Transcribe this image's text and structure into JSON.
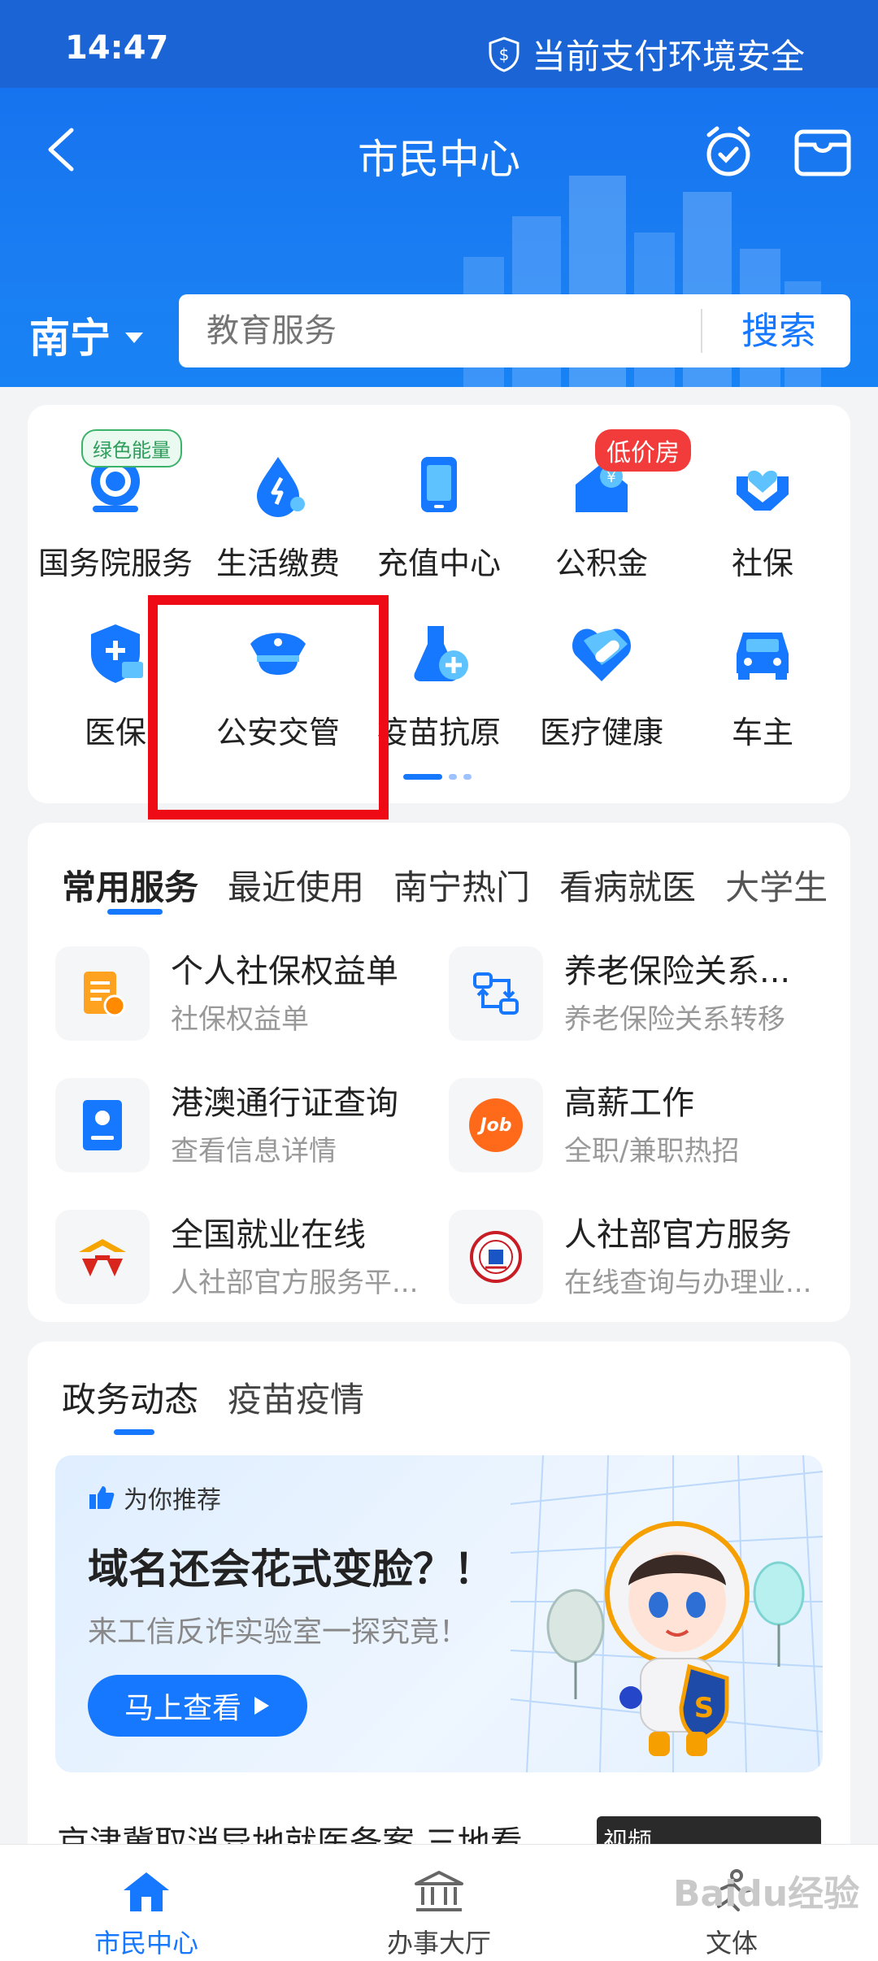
{
  "status_bar": {
    "time": "14:47",
    "safety_text": "当前支付环境安全"
  },
  "header": {
    "title": "市民中心"
  },
  "city": {
    "name": "南宁"
  },
  "search": {
    "placeholder": "教育服务",
    "button_label": "搜索"
  },
  "grid": {
    "tags": {
      "green": "绿色能量",
      "red": "低价房"
    },
    "row1": [
      {
        "label": "国务院服务",
        "icon": "state-council-icon"
      },
      {
        "label": "生活缴费",
        "icon": "utility-payment-icon"
      },
      {
        "label": "充值中心",
        "icon": "phone-recharge-icon"
      },
      {
        "label": "公积金",
        "icon": "housing-fund-icon"
      },
      {
        "label": "社保",
        "icon": "social-security-icon"
      }
    ],
    "row2": [
      {
        "label": "医保",
        "icon": "medical-insurance-icon"
      },
      {
        "label": "公安交管",
        "icon": "police-traffic-icon"
      },
      {
        "label": "疫苗抗原",
        "icon": "vaccine-antigen-icon"
      },
      {
        "label": "医疗健康",
        "icon": "medical-health-icon"
      },
      {
        "label": "车主",
        "icon": "car-owner-icon"
      }
    ]
  },
  "services": {
    "tabs": [
      "常用服务",
      "最近使用",
      "南宁热门",
      "看病就医",
      "大学生"
    ],
    "items": [
      {
        "title": "个人社保权益单",
        "subtitle": "社保权益单"
      },
      {
        "title": "养老保险关系...",
        "subtitle": "养老保险关系转移"
      },
      {
        "title": "港澳通行证查询",
        "subtitle": "查看信息详情"
      },
      {
        "title": "高薪工作",
        "subtitle": "全职/兼职热招"
      },
      {
        "title": "全国就业在线",
        "subtitle": "人社部官方服务平..."
      },
      {
        "title": "人社部官方服务",
        "subtitle": "在线查询与办理业..."
      }
    ],
    "job_logo_text": "Job"
  },
  "news": {
    "tabs": [
      "政务动态",
      "疫苗疫情"
    ],
    "banner": {
      "tag": "为你推荐",
      "title": "域名还会花式变脸？！",
      "subtitle": "来工信反诈实验室一探究竟！",
      "button": "马上查看"
    },
    "headline": "京津冀取消异地就医备案 三地看",
    "thumb_label": "视频"
  },
  "bottom_nav": [
    {
      "label": "市民中心",
      "active": true
    },
    {
      "label": "办事大厅",
      "active": false
    },
    {
      "label": "文体",
      "active": false
    }
  ],
  "watermark": "Baidu经验",
  "colors": {
    "primary": "#1677ff",
    "header": "#1a64d6",
    "highlight": "#ee0b16"
  }
}
